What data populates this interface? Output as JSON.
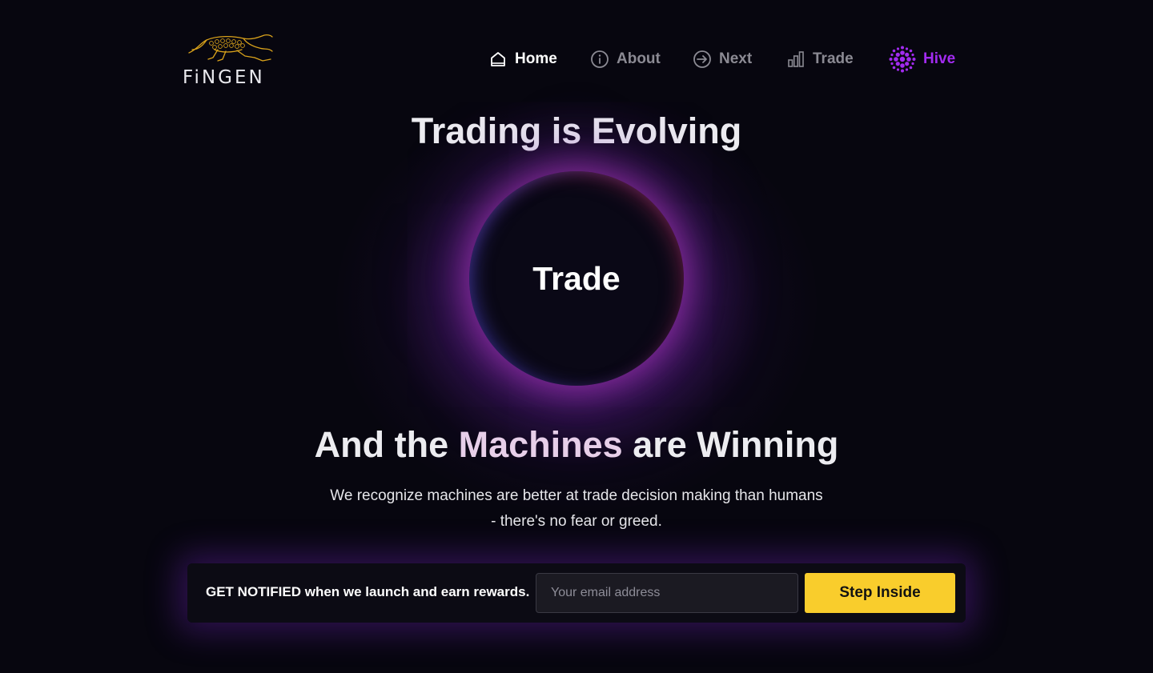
{
  "brand": {
    "name": "FiNGEN",
    "accent": "#f9cd2c"
  },
  "nav": {
    "home": "Home",
    "about": "About",
    "next": "Next",
    "trade": "Trade",
    "hive": "Hive",
    "hive_color": "#a22bf0"
  },
  "hero": {
    "title": "Trading is Evolving",
    "orb_label": "Trade",
    "subtitle_part1": "And the ",
    "subtitle_highlight": "Machines",
    "subtitle_part2": " are Winning",
    "description_line1": "We recognize machines are better at trade decision making than humans",
    "description_line2": "- there's no fear or greed."
  },
  "signup": {
    "prompt": "GET NOTIFIED when we launch and earn rewards.",
    "email_placeholder": "Your email address",
    "email_value": "",
    "button_label": "Step Inside"
  }
}
